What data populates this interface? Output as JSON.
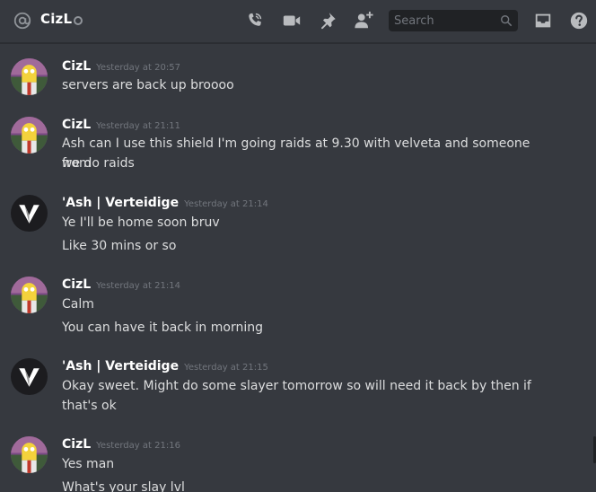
{
  "header": {
    "channel_name": "CizL",
    "search_placeholder": "Search"
  },
  "colors": {
    "background": "#36393f",
    "text": "#dcddde",
    "username": "#ffffff",
    "timestamp": "#72767d",
    "icon": "#b9bbbe"
  },
  "messages": [
    {
      "author": "CizL",
      "timestamp": "Yesterday at 20:57",
      "lines": [
        "servers are back up broooo"
      ]
    },
    {
      "author": "CizL",
      "timestamp": "Yesterday at 21:11",
      "lines": [
        "Ash can I use this shield I'm going raids at 9.30 with velveta and someone from",
        "we do raids"
      ]
    },
    {
      "author": "'Ash | Verteidige",
      "timestamp": "Yesterday at 21:14",
      "lines": [
        "Ye I'll be home soon bruv",
        "Like 30 mins or so"
      ]
    },
    {
      "author": "CizL",
      "timestamp": "Yesterday at 21:14",
      "lines": [
        "Calm",
        "You can have it back in morning"
      ]
    },
    {
      "author": "'Ash | Verteidige",
      "timestamp": "Yesterday at 21:15",
      "lines": [
        "Okay sweet. Might do some slayer tomorrow so will need it  back by then if",
        "that's ok"
      ]
    },
    {
      "author": "CizL",
      "timestamp": "Yesterday at 21:16",
      "lines": [
        "Yes man",
        "What's your slay lvl"
      ]
    }
  ]
}
